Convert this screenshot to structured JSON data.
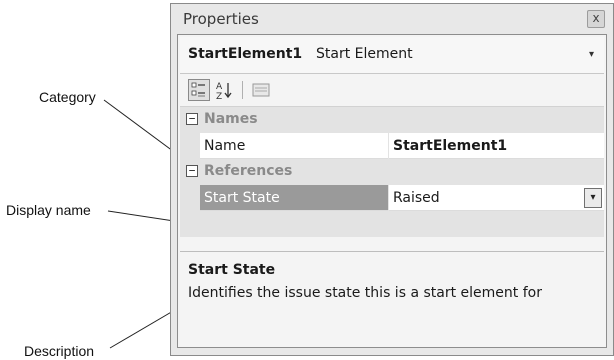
{
  "callouts": {
    "category": "Category",
    "display_name": "Display name",
    "description": "Description"
  },
  "window": {
    "title": "Properties",
    "close_glyph": "x"
  },
  "selector": {
    "object_name": "StartElement1",
    "object_type": "Start Element",
    "arrow": "▾"
  },
  "toolbar": {
    "icons": [
      "categorized-icon",
      "alphabetical-sort-icon",
      "property-pages-icon"
    ],
    "alpha_glyph": "A\nZ"
  },
  "grid": {
    "categories": [
      {
        "toggle": "−",
        "label": "Names",
        "properties": [
          {
            "name": "Name",
            "value": "StartElement1",
            "bold": true
          }
        ]
      },
      {
        "toggle": "−",
        "label": "References",
        "properties": [
          {
            "name": "Start State",
            "value": "Raised",
            "selected": true,
            "dropdown": "▾"
          }
        ]
      }
    ]
  },
  "description_pane": {
    "title": "Start State",
    "text": "Identifies the issue state this is a start element for"
  },
  "colors": {
    "window_bg": "#e8e8e8",
    "selected_row": "#9a9a9a",
    "category_text": "#8a8a8a"
  }
}
